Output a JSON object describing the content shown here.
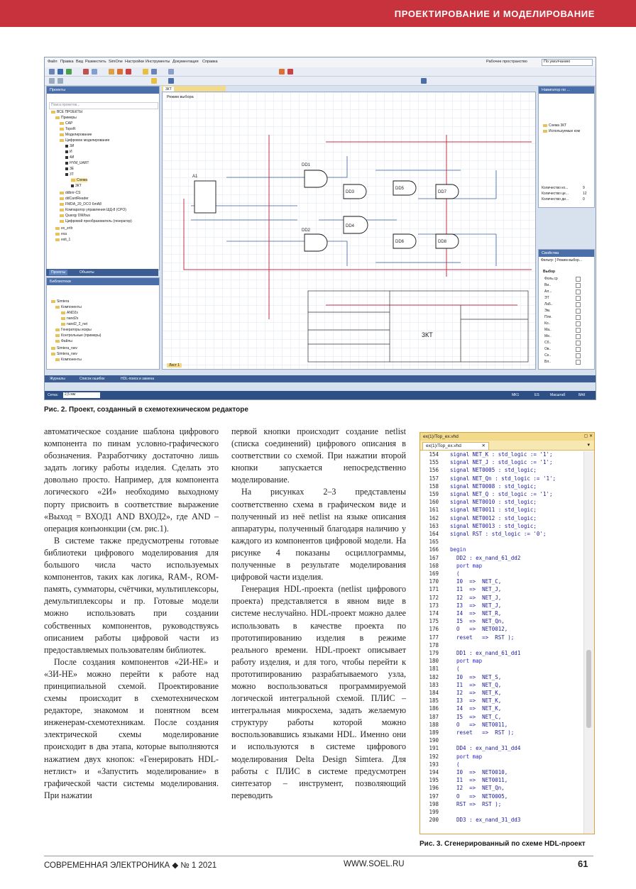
{
  "header": {
    "section_title": "ПРОЕКТИРОВАНИЕ И МОДЕЛИРОВАНИЕ",
    "color": "#c8323c"
  },
  "screenshot": {
    "menu": [
      "Файл",
      "Правка",
      "Вид",
      "Разместить",
      "SimOne",
      "Настройки",
      "Инструменты",
      "Документация",
      "Справка"
    ],
    "workspace_label": "Рабочее пространство",
    "workspace_value": "По умолчанию",
    "projects_panel_title": "Проекты",
    "search_placeholder": "Поиск проектов...",
    "tree": [
      "ВСЕ ПРОЕКТЫ",
      "Примеры",
      "CAP",
      "TopoR",
      "Моделирование",
      "Цифровое моделирование",
      "3И",
      "И",
      "4И",
      "HYM_UART",
      "3Е",
      "3Т",
      "Схема",
      "3КТ",
      "ddbnr-CS",
      "ddCardReader",
      "FMDA_20_DCO 6mA8",
      "Компаратор управления ШД-8 (CPO)",
      "Quarqy DM/bus",
      "Цифровой преобразователь (генератор)",
      "ex_zrtlr",
      "exa",
      "exit_1"
    ],
    "tabs_bottom": [
      "Проекты",
      "Объекты"
    ],
    "lib_panel_title": "Библиотеки",
    "lib_tree": [
      "Simtera",
      "Компоненты",
      "AND2s",
      "nand2s",
      "nand2_2_net",
      "Генераторы искры",
      "Контрольные (примеры)",
      "Файлы",
      "Simtera_nwv",
      "Simtera_nwv",
      "Компоненты"
    ],
    "doc_tab": "3КТ",
    "mode_label": "Режим выбора",
    "gates": [
      "DD1",
      "DD2",
      "DD3",
      "DD4",
      "DD5",
      "DD6",
      "DD7",
      "DD8",
      "A1"
    ],
    "title_block": "3КТ",
    "sheet_tab": "Лист 1",
    "navigator_title": "Навигатор по ...",
    "navigator_items": [
      "Схема 3КТ",
      "Используемые ком"
    ],
    "nav_stats": [
      [
        "Количество ко...",
        "9"
      ],
      [
        "Количество це...",
        "12"
      ],
      [
        "Количество ди...",
        "0"
      ]
    ],
    "props_title": "Свойства",
    "filter_label": "Фильтр: [ Режим выбор...",
    "props_group": "Выбор",
    "props_rows": [
      "Фоль.ср",
      "Ви..",
      "Ал...",
      "ЭТ",
      "Ла5..",
      "Эм.",
      "Пле.",
      "Ко..",
      "Ма..",
      "Ме..",
      "Сб..",
      "Ов..",
      "Се..",
      "Вл.."
    ],
    "bottom_tabs": [
      "Журналы",
      "Список ошибок",
      "HDL-поиск и замена"
    ],
    "status_left": "Сетка:",
    "status_grid": "2,5 мм",
    "status_right": [
      "MK1",
      "ES",
      "Масштаб",
      "ВАК"
    ]
  },
  "fig2_caption": "Рис. 2. Проект, созданный в схемотехническом редакторе",
  "col1": [
    "автоматическое создание шаблона цифрового компонента по пинам условно-графического обозначения. Разработчику достаточно лишь задать логику работы изделия. Сделать это довольно просто. Например, для компонента логического «2И» необходимо выходному порту присвоить в соответствие выражение «Выход = ВХОД1 AND ВХОД2», где AND – операция конъюнкции (см. рис.1).",
    "В системе также предусмотрены готовые библиотеки цифрового моделирования для большого числа часто используемых компонентов, таких как логика, RAM-, ROM-память, сумматоры, счётчики, мультиплексоры, демультиплексоры и пр. Готовые модели можно использовать при создании собственных компонентов, руководствуясь описанием работы цифровой части из предоставляемых пользователям библиотек.",
    "После создания компонентов «2И-НЕ» и «3И-НЕ» можно перейти к работе над принципиальной схемой. Проектирование схемы происходит в схемотехническом редакторе, знакомом и понятном всем инженерам-схемотехникам. После создания электрической схемы моделирование происходит в два этапа, которые выполняются нажатием двух кнопок: «Генерировать HDL-нетлист» и «Запустить моделирование» в графической части системы моделирования. При нажатии"
  ],
  "col2": [
    "первой кнопки происходит создание netlist (списка соединений) цифрового описания в соответствии со схемой. При нажатии второй кнопки запускается непосредственно моделирование.",
    "На рисунках 2–3 представлены соответственно схема в графическом виде и полученный из неё netlist на языке описания аппаратуры, полученный благодаря наличию у каждого из компонентов цифровой модели. На рисунке 4 показаны осциллограммы, полученные в результате моделирования цифровой части изделия.",
    "Генерация HDL-проекта (netlist цифрового проекта) представляется в явном виде в системе неслучайно. HDL-проект можно далее использовать в качестве проекта по прототипированию изделия в режиме реального времени. HDL-проект описывает работу изделия, и для того, чтобы перейти к прототипированию разрабатываемого узла, можно воспользоваться программируемой логической интегральной схемой. ПЛИС – интегральная микросхема, задать желаемую структуру работы которой можно воспользовавшись языками HDL. Именно они и используются в системе цифрового моделирования Delta Design Simtera. Для работы с ПЛИС в системе предусмотрен синтезатор – инструмент, позволяющий переводить"
  ],
  "editor": {
    "window_title": "ex(1)/Top_ex.vhd",
    "tab_label": "ex(1)/Top_ex.vhd",
    "lines": [
      [
        "154",
        "signal NET_K : std_logic := '1';"
      ],
      [
        "155",
        "signal NET_J : std_logic := '1';"
      ],
      [
        "156",
        "signal NET0005 : std_logic;"
      ],
      [
        "157",
        "signal NET_Qn : std_logic := '1';"
      ],
      [
        "158",
        "signal NET0008 : std_logic;"
      ],
      [
        "159",
        "signal NET_Q : std_logic := '1';"
      ],
      [
        "160",
        "signal NET0010 : std_logic;"
      ],
      [
        "161",
        "signal NET0011 : std_logic;"
      ],
      [
        "162",
        "signal NET0012 : std_logic;"
      ],
      [
        "163",
        "signal NET0013 : std_logic;"
      ],
      [
        "164",
        "signal RST : std_logic := '0';"
      ],
      [
        "165",
        ""
      ],
      [
        "166",
        "begin"
      ],
      [
        "167",
        "  DD2 : ex_nand_61_dd2"
      ],
      [
        "168",
        "  port map"
      ],
      [
        "169",
        "  ("
      ],
      [
        "170",
        "  I0  =>  NET_C,"
      ],
      [
        "171",
        "  I1  =>  NET_J,"
      ],
      [
        "172",
        "  I2  =>  NET_J,"
      ],
      [
        "173",
        "  I3  =>  NET_J,"
      ],
      [
        "174",
        "  I4  =>  NET_R,"
      ],
      [
        "175",
        "  I5  =>  NET_Qn,"
      ],
      [
        "176",
        "  O   =>  NET0012,"
      ],
      [
        "177",
        "  reset   =>  RST );"
      ],
      [
        "178",
        ""
      ],
      [
        "179",
        "  DD1 : ex_nand_61_dd1"
      ],
      [
        "180",
        "  port map"
      ],
      [
        "181",
        "  ("
      ],
      [
        "182",
        "  I0  =>  NET_S,"
      ],
      [
        "183",
        "  I1  =>  NET_Q,"
      ],
      [
        "184",
        "  I2  =>  NET_K,"
      ],
      [
        "185",
        "  I3  =>  NET_K,"
      ],
      [
        "186",
        "  I4  =>  NET_K,"
      ],
      [
        "187",
        "  I5  =>  NET_C,"
      ],
      [
        "188",
        "  O   =>  NET0011,"
      ],
      [
        "189",
        "  reset   =>  RST );"
      ],
      [
        "190",
        ""
      ],
      [
        "191",
        "  DD4 : ex_nand_31_dd4"
      ],
      [
        "192",
        "  port map"
      ],
      [
        "193",
        "  ("
      ],
      [
        "194",
        "  I0  =>  NET0010,"
      ],
      [
        "195",
        "  I1  =>  NET0011,"
      ],
      [
        "196",
        "  I2  =>  NET_Qn,"
      ],
      [
        "197",
        "  O   =>  NET0005,"
      ],
      [
        "198",
        "  RST =>  RST );"
      ],
      [
        "199",
        ""
      ],
      [
        "200",
        "  DD3 : ex_nand_31_dd3"
      ]
    ]
  },
  "fig3_caption": "Рис. 3. Сгенерированный по схеме HDL-проект",
  "footer": {
    "journal": "СОВРЕМЕННАЯ ЭЛЕКТРОНИКА ◆ № 1 2021",
    "site": "WWW.SOEL.RU",
    "page": "61"
  }
}
